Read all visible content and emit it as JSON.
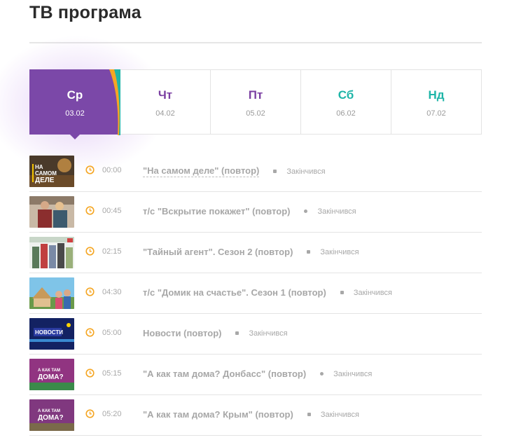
{
  "page": {
    "title": "ТВ програма"
  },
  "days": [
    {
      "name": "Ср",
      "date": "03.02",
      "active": true
    },
    {
      "name": "Чт",
      "date": "04.02",
      "active": false
    },
    {
      "name": "Пт",
      "date": "05.02",
      "active": false
    },
    {
      "name": "Сб",
      "date": "06.02",
      "active": false
    },
    {
      "name": "Нд",
      "date": "07.02",
      "active": false
    }
  ],
  "colors": {
    "accent_purple": "#7b48a8",
    "accent_teal": "#1fb5a8",
    "accent_orange": "#f5a623"
  },
  "programs": [
    {
      "time": "00:00",
      "title": "\"На самом деле\" (повтор)",
      "status": "Закінчився",
      "thumb_text": [
        "НА",
        "САМОМ",
        "ДЕЛЕ"
      ]
    },
    {
      "time": "00:45",
      "title": "т/с \"Вскрытие покажет\" (повтор)",
      "status": "Закінчився"
    },
    {
      "time": "02:15",
      "title": "\"Тайный агент\". Сезон 2 (повтор)",
      "status": "Закінчився"
    },
    {
      "time": "04:30",
      "title": "т/с \"Домик на счастье\". Сезон 1 (повтор)",
      "status": "Закінчився"
    },
    {
      "time": "05:00",
      "title": "Новости (повтор)",
      "status": "Закінчився",
      "thumb_text": [
        "НОВОСТИ"
      ]
    },
    {
      "time": "05:15",
      "title": "\"А как там дома? Донбасс\" (повтор)",
      "status": "Закінчився",
      "thumb_text": [
        "А КАК ТАМ",
        "ДОМА?"
      ]
    },
    {
      "time": "05:20",
      "title": "\"А как там дома? Крым\" (повтор)",
      "status": "Закінчився",
      "thumb_text": [
        "А КАК ТАМ",
        "ДОМА?"
      ]
    }
  ]
}
